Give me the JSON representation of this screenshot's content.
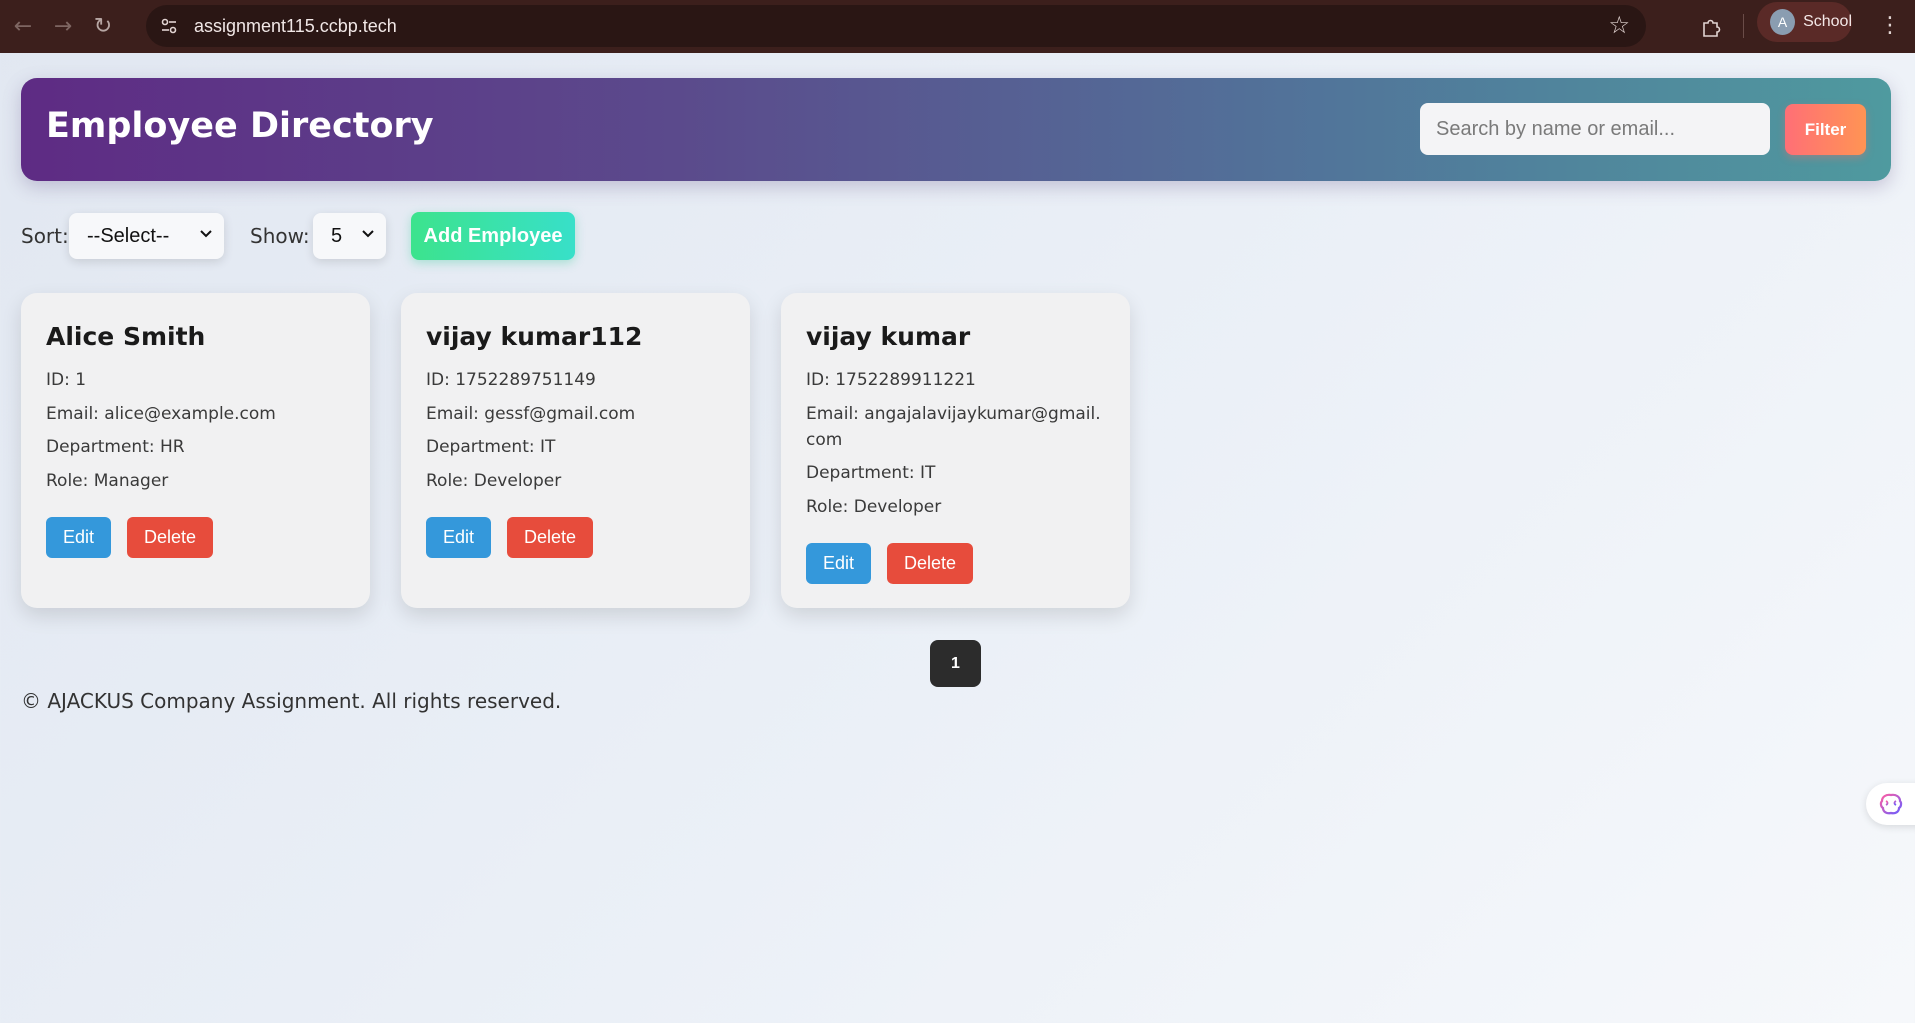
{
  "browser": {
    "url": "assignment115.ccbp.tech",
    "profile_initial": "A",
    "profile_label": "School",
    "back_glyph": "←",
    "forward_glyph": "→",
    "reload_glyph": "↻",
    "star_glyph": "☆",
    "menu_glyph": "⋮"
  },
  "header": {
    "title": "Employee Directory",
    "search_placeholder": "Search by name or email...",
    "filter_label": "Filter"
  },
  "controls": {
    "sort_label": "Sort:",
    "sort_value": "--Select--",
    "show_label": "Show:",
    "show_value": "5",
    "add_label": "Add Employee"
  },
  "employees": [
    {
      "name": "Alice Smith",
      "id": "ID: 1",
      "email": "Email: alice@example.com",
      "department": "Department: HR",
      "role": "Role: Manager",
      "edit": "Edit",
      "delete": "Delete"
    },
    {
      "name": "vijay kumar112",
      "id": "ID: 1752289751149",
      "email": "Email: gessf@gmail.com",
      "department": "Department: IT",
      "role": "Role: Developer",
      "edit": "Edit",
      "delete": "Delete"
    },
    {
      "name": "vijay kumar",
      "id": "ID: 1752289911221",
      "email": "Email: angajalavijaykumar@gmail.com",
      "department": "Department: IT",
      "role": "Role: Developer",
      "edit": "Edit",
      "delete": "Delete"
    }
  ],
  "pagination": {
    "current": "1"
  },
  "footer": {
    "text": "© AJACKUS Company Assignment. All rights reserved."
  },
  "colors": {
    "edit": "#3498db",
    "delete": "#e74c3c",
    "add": "#3ce38d",
    "filter": "#ff7f66"
  }
}
